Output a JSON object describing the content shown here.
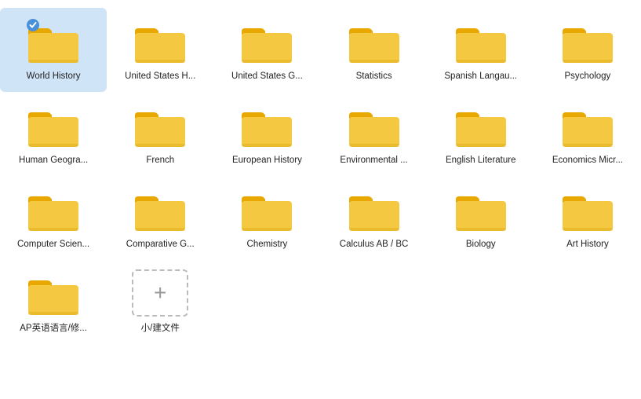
{
  "folders": [
    {
      "id": 1,
      "label": "World History",
      "selected": true
    },
    {
      "id": 2,
      "label": "United States H..."
    },
    {
      "id": 3,
      "label": "United States G..."
    },
    {
      "id": 4,
      "label": "Statistics"
    },
    {
      "id": 5,
      "label": "Spanish Langau..."
    },
    {
      "id": 6,
      "label": "Psychology"
    },
    {
      "id": 7,
      "label": "Human Geogra..."
    },
    {
      "id": 8,
      "label": "French"
    },
    {
      "id": 9,
      "label": "European History"
    },
    {
      "id": 10,
      "label": "Environmental ..."
    },
    {
      "id": 11,
      "label": "English Literature"
    },
    {
      "id": 12,
      "label": "Economics Micr..."
    },
    {
      "id": 13,
      "label": "Computer Scien..."
    },
    {
      "id": 14,
      "label": "Comparative G..."
    },
    {
      "id": 15,
      "label": "Chemistry"
    },
    {
      "id": 16,
      "label": "Calculus AB / BC"
    },
    {
      "id": 17,
      "label": "Biology"
    },
    {
      "id": 18,
      "label": "Art History"
    },
    {
      "id": 19,
      "label": "AP英语语言/修..."
    }
  ],
  "newFolder": {
    "label": "小/建文件"
  },
  "colors": {
    "folderBody": "#F5C842",
    "folderTab": "#E8A800"
  }
}
